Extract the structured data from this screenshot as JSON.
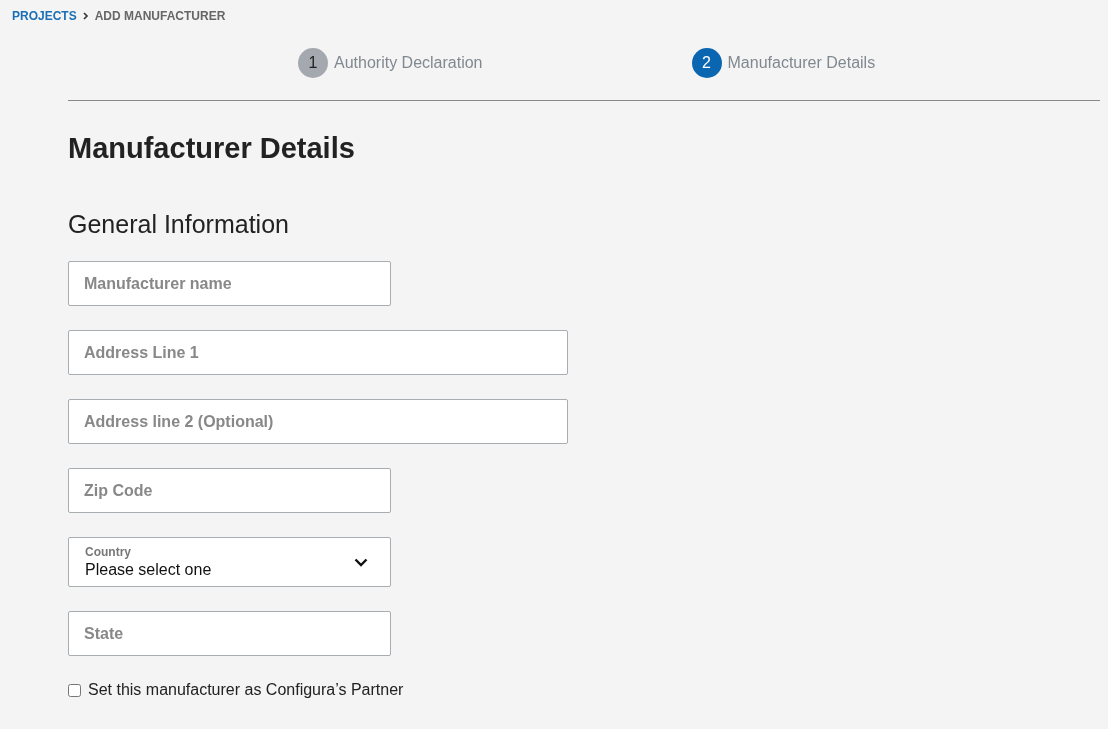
{
  "breadcrumb": [
    {
      "label": "PROJECTS",
      "kind": "link"
    },
    {
      "label": "ADD MANUFACTURER",
      "kind": "current"
    }
  ],
  "steps": [
    {
      "number": "1",
      "label": "Authority Declaration",
      "selected": false
    },
    {
      "number": "2",
      "label": "Manufacturer Details",
      "selected": true
    }
  ],
  "heading": "Manufacturer Details",
  "section_title": "General Information",
  "fields": [
    {
      "kind": "text",
      "placeholder": "Manufacturer name",
      "wide": false
    },
    {
      "kind": "text",
      "placeholder": "Address Line 1",
      "wide": true
    },
    {
      "kind": "text",
      "placeholder": "Address line 2 (Optional)",
      "wide": true
    },
    {
      "kind": "text",
      "placeholder": "Zip Code",
      "wide": false
    },
    {
      "kind": "select",
      "label": "Country",
      "value": "Please select one",
      "wide": false
    },
    {
      "kind": "text",
      "placeholder": "State",
      "wide": false
    }
  ],
  "partner_checkbox": {
    "label": "Set this manufacturer as Configura’s Partner",
    "checked": false
  }
}
